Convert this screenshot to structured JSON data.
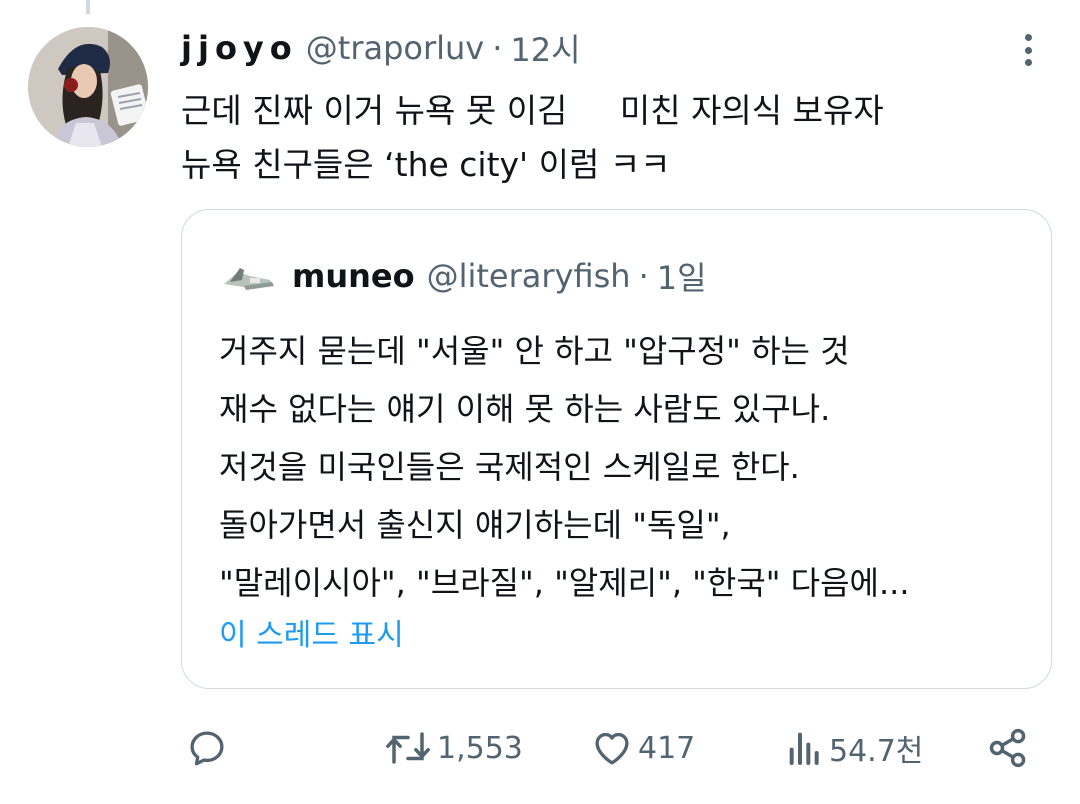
{
  "tweet": {
    "display_name": "jjoyo",
    "handle": "@traporluv",
    "separator": "·",
    "time": "12시",
    "text_lines": [
      "근데 진짜 이거 뉴욕 못 이김     미친 자의식 보유자",
      "뉴욕 친구들은 ‘the city' 이럼 ㅋㅋ"
    ]
  },
  "quote": {
    "display_name": "muneo",
    "handle": "@literaryfish",
    "separator": "·",
    "time": "1일",
    "text_lines": [
      "거주지 묻는데 \"서울\" 안 하고 \"압구정\" 하는 것",
      "재수 없다는 얘기 이해 못 하는 사람도 있구나.",
      "저것을 미국인들은 국제적인 스케일로 한다.",
      "돌아가면서 출신지 얘기하는데 \"독일\",",
      "\"말레이시아\", \"브라질\", \"알제리\", \"한국\" 다음에..."
    ],
    "show_thread": "이 스레드 표시"
  },
  "actions": {
    "reply": {
      "icon": "reply-icon",
      "count": ""
    },
    "retweet": {
      "icon": "retweet-icon",
      "count": "1,553"
    },
    "like": {
      "icon": "heart-icon",
      "count": "417"
    },
    "views": {
      "icon": "views-icon",
      "count": "54.7천"
    },
    "share": {
      "icon": "share-icon",
      "count": ""
    }
  },
  "colors": {
    "text": "#0f1419",
    "secondary": "#536471",
    "link": "#1d9bf0",
    "border": "#cfd9de"
  }
}
